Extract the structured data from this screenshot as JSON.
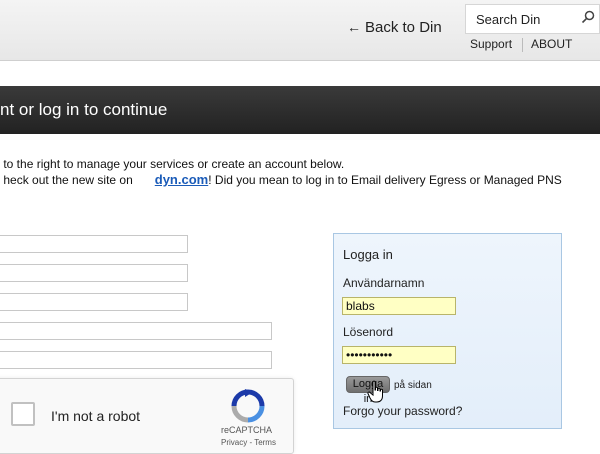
{
  "header": {
    "back_label": "Back to Din",
    "search_placeholder": "Search Din",
    "nav": [
      "Support",
      "ABOUT"
    ]
  },
  "banner": {
    "title": "nt or log in to continue"
  },
  "intro": {
    "line1": "to the right to manage your services or create an account below.",
    "line2_prefix": "heck out the new site on",
    "line2_link": "dyn.com",
    "line2_suffix": "!  Did you mean to log in to Email delivery Egress or Managed PNS"
  },
  "captcha": {
    "label": "I'm not a robot",
    "brand": "reCAPTCHA",
    "terms": "Privacy - Terms"
  },
  "login": {
    "title": "Logga in",
    "username_label": "Användarnamn",
    "username_value": "blabs",
    "password_label": "Lösenord",
    "password_value": "•••••••••••",
    "button_label": "Logga in",
    "stay_label": "på sidan",
    "forgot_label": "Forgo your password?"
  },
  "colors": {
    "banner": "#2b2b2b",
    "link": "#1a5bb8",
    "panel_bg": "#e8f1fb",
    "input_fill": "#ffffc4"
  },
  "icons": [
    "search-icon",
    "arrow-left-icon",
    "recaptcha-logo-icon",
    "hand-cursor-icon"
  ]
}
